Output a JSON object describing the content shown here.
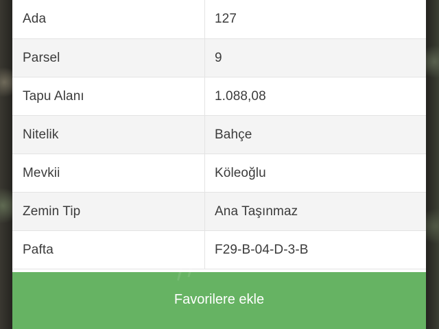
{
  "details": [
    {
      "label": "Ada",
      "value": "127"
    },
    {
      "label": "Parsel",
      "value": "9"
    },
    {
      "label": "Tapu Alanı",
      "value": "1.088,08"
    },
    {
      "label": "Nitelik",
      "value": "Bahçe"
    },
    {
      "label": "Mevkii",
      "value": "Köleoğlu"
    },
    {
      "label": "Zemin Tip",
      "value": "Ana Taşınmaz"
    },
    {
      "label": "Pafta",
      "value": "F29-B-04-D-3-B"
    }
  ],
  "favorite_button": {
    "label": "Favorilere ekle"
  },
  "colors": {
    "button_green": "#66b363",
    "text": "#3b3b3b"
  }
}
